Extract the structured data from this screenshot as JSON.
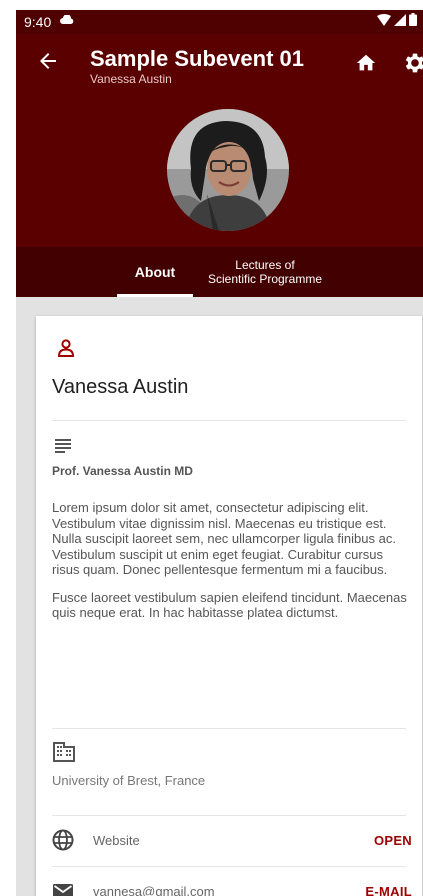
{
  "status_bar": {
    "time": "9:40"
  },
  "app_bar": {
    "title": "Sample Subevent 01",
    "subtitle": "Vanessa Austin",
    "icons": [
      "back-arrow-icon",
      "home-icon",
      "gear-icon"
    ],
    "background_color": "#5b0000"
  },
  "tabs": [
    {
      "label": "About",
      "selected": true
    },
    {
      "label_line1": "Lectures of",
      "label_line2": "Scientific Programme",
      "selected": false
    }
  ],
  "profile": {
    "name": "Vanessa Austin",
    "bio_title": "Prof. Vanessa Austin MD",
    "bio_paragraphs": [
      "Lorem ipsum dolor sit amet, consectetur adipiscing elit. Vestibulum vitae dignissim nisl. Maecenas eu tristique est. Nulla suscipit laoreet sem, nec ullamcorper ligula finibus ac. Vestibulum suscipit ut enim eget feugiat. Curabitur cursus risus quam. Donec pellentesque fermentum mi a faucibus.",
      "Fusce laoreet vestibulum sapien eleifend tincidunt. Maecenas quis neque erat. In hac habitasse platea dictumst."
    ],
    "affiliation": "University of Brest, France"
  },
  "contacts": [
    {
      "icon": "globe-icon",
      "label": "Website",
      "action": "OPEN"
    },
    {
      "icon": "mail-icon",
      "label": "vannesa@gmail.com",
      "action": "E-MAIL"
    }
  ],
  "colors": {
    "accent": "#a00000",
    "tab_bar": "#430000",
    "status_bar": "#4f0000"
  }
}
